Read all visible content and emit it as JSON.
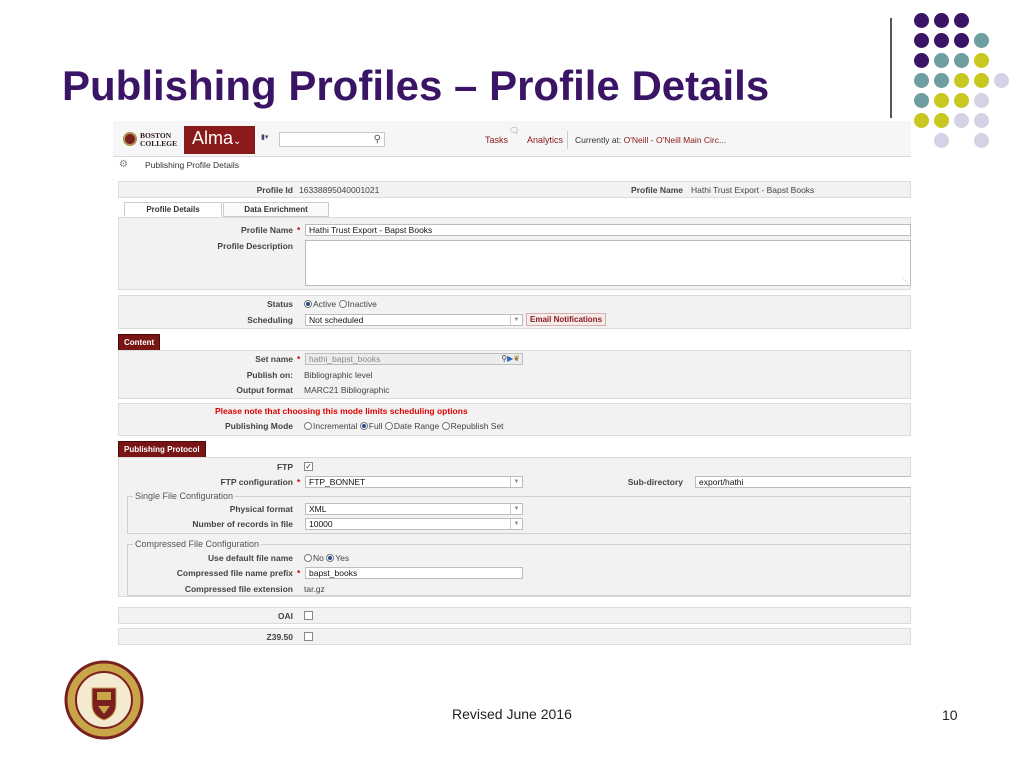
{
  "slide": {
    "title": "Publishing Profiles – Profile Details",
    "footer": "Revised June 2016",
    "page_number": "10",
    "dot_colors": [
      "#3b1565",
      "#6e9ea0",
      "#c8c820",
      "#d6d2e6"
    ]
  },
  "header": {
    "logo_line1": "BOSTON",
    "logo_line2": "COLLEGE",
    "app_name": "Alma",
    "search_placeholder": "",
    "tasks": "Tasks",
    "analytics": "Analytics",
    "currently_at_label": "Currently at:",
    "currently_at_value": "O'Neill - O'Neill Main Circ..."
  },
  "breadcrumb": "Publishing Profile Details",
  "summary": {
    "profile_id_label": "Profile Id",
    "profile_id": "16338895040001021",
    "profile_name_label": "Profile Name",
    "profile_name": "Hathi Trust Export - Bapst Books"
  },
  "tabs": [
    {
      "label": "Profile Details",
      "active": true
    },
    {
      "label": "Data Enrichment",
      "active": false
    }
  ],
  "details": {
    "profile_name_label": "Profile Name",
    "profile_name_value": "Hathi Trust Export - Bapst Books",
    "description_label": "Profile Description",
    "description_value": ""
  },
  "status": {
    "label": "Status",
    "options": [
      "Active",
      "Inactive"
    ],
    "selected": "Active",
    "scheduling_label": "Scheduling",
    "scheduling_value": "Not scheduled",
    "email_button": "Email Notifications"
  },
  "content": {
    "section_label": "Content",
    "set_name_label": "Set name",
    "set_name_value": "hathi_bapst_books",
    "publish_on_label": "Publish on:",
    "publish_on_value": "Bibliographic level",
    "output_format_label": "Output format",
    "output_format_value": "MARC21 Bibliographic"
  },
  "mode": {
    "note": "Please note that choosing this mode limits scheduling options",
    "label": "Publishing Mode",
    "options": [
      "Incremental",
      "Full",
      "Date Range",
      "Republish Set"
    ],
    "selected": "Full"
  },
  "protocol": {
    "section_label": "Publishing Protocol",
    "ftp_label": "FTP",
    "ftp_checked": true,
    "ftp_config_label": "FTP configuration",
    "ftp_config_value": "FTP_BONNET",
    "subdirectory_label": "Sub-directory",
    "subdirectory_value": "export/hathi",
    "single_file_title": "Single File Configuration",
    "physical_format_label": "Physical format",
    "physical_format_value": "XML",
    "records_label": "Number of records in file",
    "records_value": "10000",
    "compressed_title": "Compressed File Configuration",
    "default_name_label": "Use default file name",
    "default_name_options": [
      "No",
      "Yes"
    ],
    "default_name_selected": "Yes",
    "prefix_label": "Compressed file name prefix",
    "prefix_value": "bapst_books",
    "extension_label": "Compressed file extension",
    "extension_value": "tar.gz"
  },
  "oai": {
    "label": "OAI",
    "checked": false
  },
  "z3950": {
    "label": "Z39.50",
    "checked": false
  }
}
